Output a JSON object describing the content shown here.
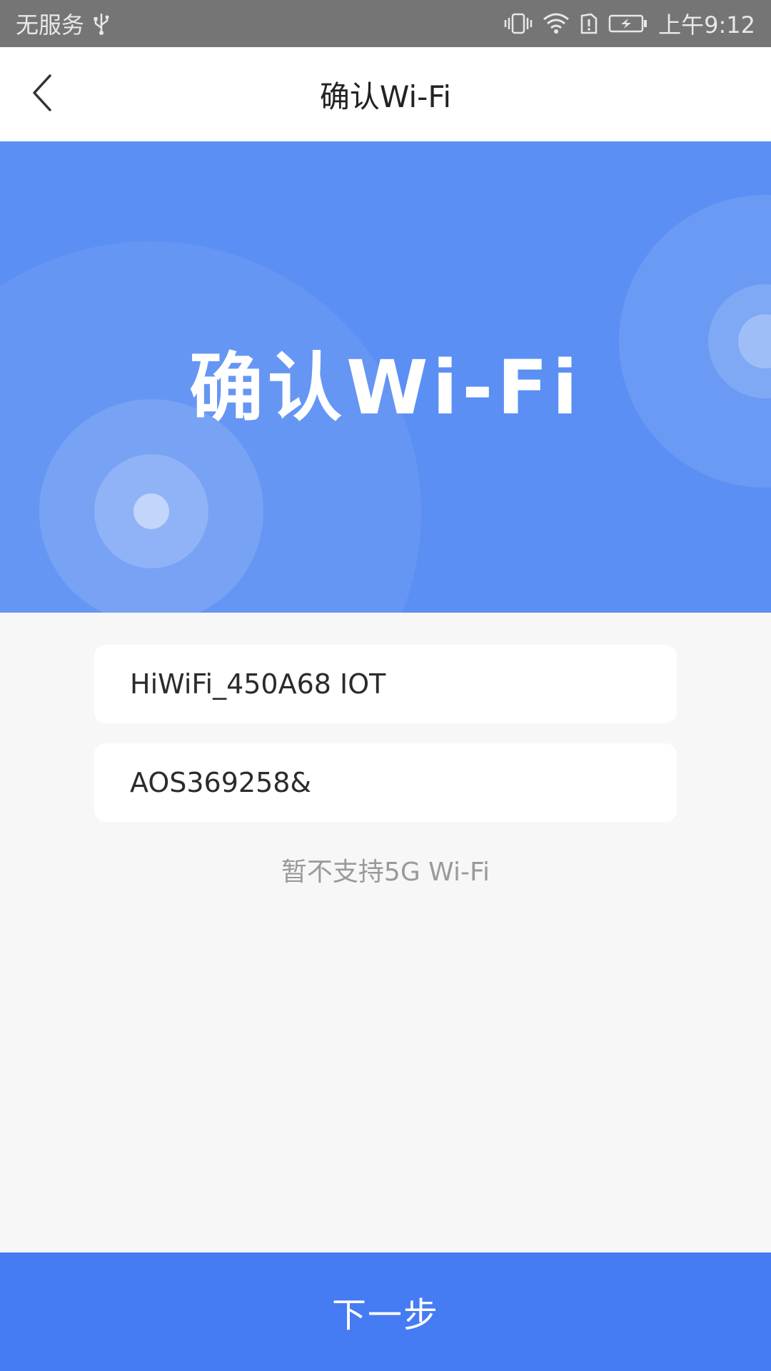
{
  "status_bar": {
    "carrier": "无服务",
    "time": "上午9:12",
    "icons": [
      "usb-icon",
      "vibrate-icon",
      "wifi-icon",
      "sim-alert-icon",
      "battery-charging-icon"
    ]
  },
  "nav": {
    "title": "确认Wi-Fi",
    "back_icon": "chevron-left-icon"
  },
  "hero": {
    "title": "确认Wi-Fi",
    "background_color": "#5b8ff3"
  },
  "form": {
    "ssid_value": "HiWiFi_450A68 IOT",
    "password_value": "AOS369258&",
    "hint": "暂不支持5G Wi-Fi"
  },
  "footer": {
    "next_label": "下一步",
    "button_color": "#457bf3"
  }
}
